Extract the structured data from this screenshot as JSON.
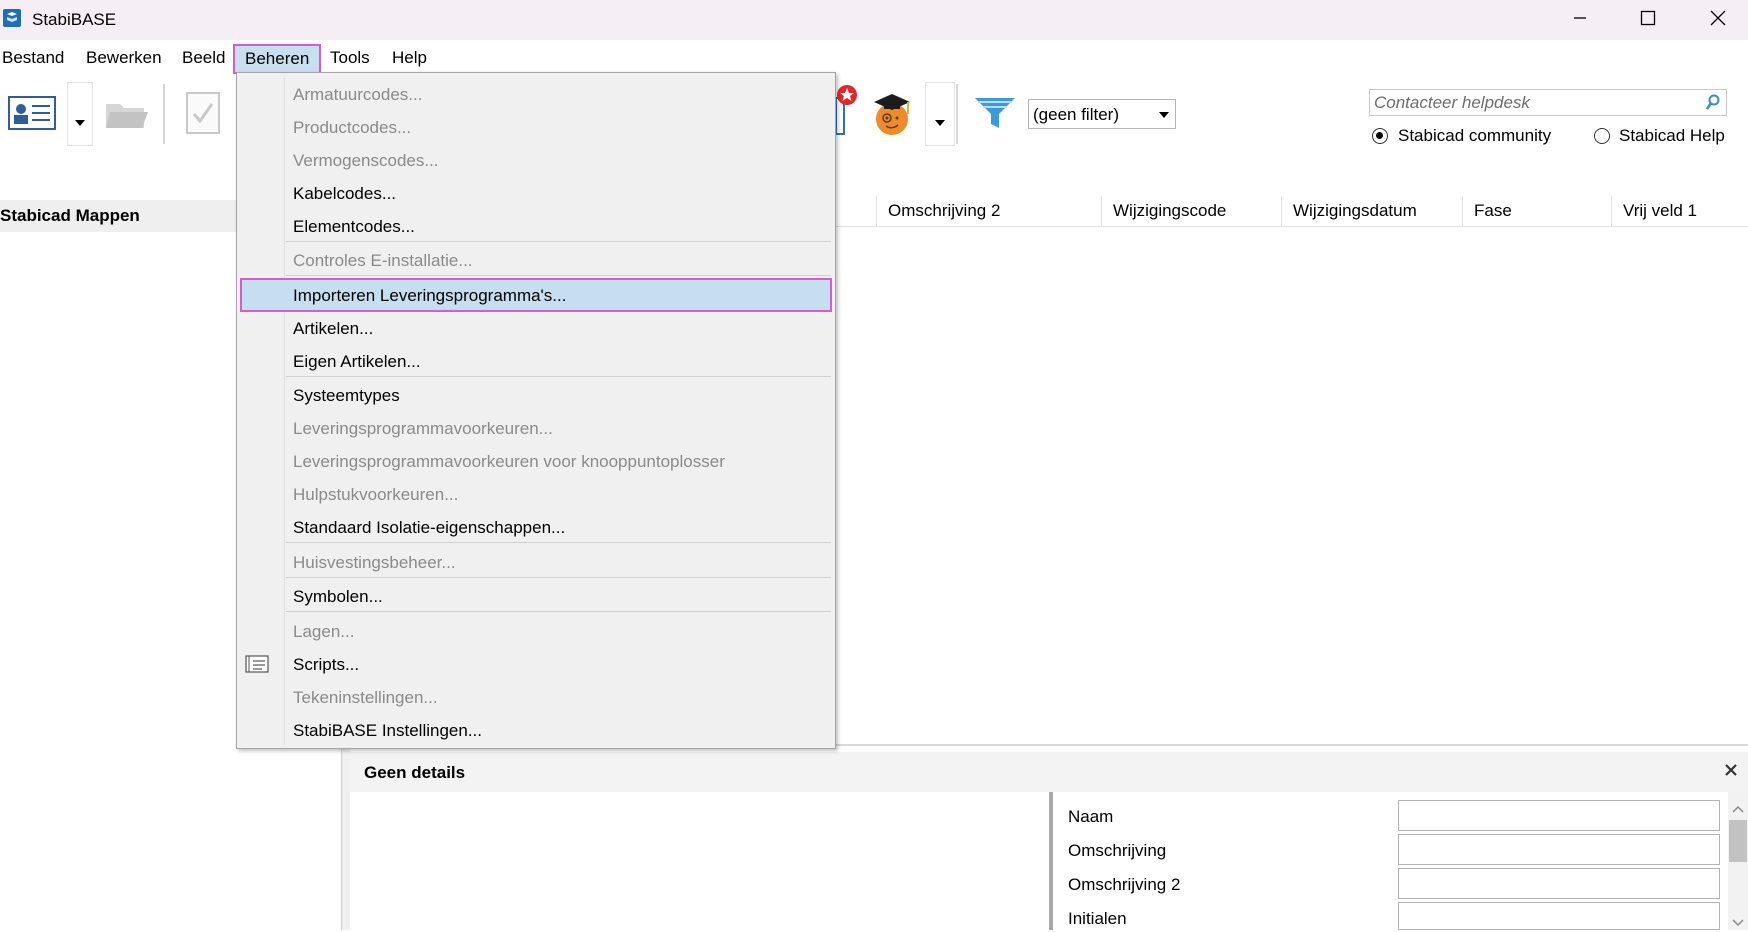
{
  "window": {
    "title": "StabiBASE",
    "controls": {
      "minimize": "minimize-icon",
      "maximize": "maximize-icon",
      "close": "close-icon"
    }
  },
  "menubar": {
    "items": [
      "Bestand",
      "Bewerken",
      "Beeld",
      "Beheren",
      "Tools",
      "Help"
    ],
    "active": "Beheren"
  },
  "toolbar": {
    "icons": [
      "contact-card-icon",
      "dropdown-arrow-icon",
      "open-folder-icon",
      "checklist-icon",
      "notification-icon",
      "student-avatar-icon",
      "dropdown-arrow-icon",
      "filter-icon"
    ],
    "filter_value": "(geen filter)"
  },
  "helpdesk": {
    "placeholder": "Contacteer helpdesk",
    "options": [
      "Stabicad community",
      "Stabicad Help"
    ],
    "selected": "Stabicad community"
  },
  "left_panel": {
    "title": "Stabicad Mappen"
  },
  "columns": [
    "Omschrijving 2",
    "Wijzigingscode",
    "Wijzigingsdatum",
    "Fase",
    "Vrij veld 1"
  ],
  "beheren_menu": {
    "items": [
      {
        "label": "Armatuurcodes...",
        "enabled": false
      },
      {
        "label": "Productcodes...",
        "enabled": false
      },
      {
        "label": "Vermogenscodes...",
        "enabled": false
      },
      {
        "label": "Kabelcodes...",
        "enabled": true
      },
      {
        "label": "Elementcodes...",
        "enabled": true
      },
      {
        "label": "Controles E-installatie...",
        "enabled": false
      },
      {
        "label": "Importeren Leveringsprogramma's...",
        "enabled": true,
        "highlighted": true
      },
      {
        "label": "Artikelen...",
        "enabled": true
      },
      {
        "label": "Eigen Artikelen...",
        "enabled": true
      },
      {
        "label": "Systeemtypes",
        "enabled": true
      },
      {
        "label": "Leveringsprogrammavoorkeuren...",
        "enabled": false
      },
      {
        "label": "Leveringsprogrammavoorkeuren voor knooppuntoplosser",
        "enabled": false
      },
      {
        "label": "Hulpstukvoorkeuren...",
        "enabled": false
      },
      {
        "label": "Standaard Isolatie-eigenschappen...",
        "enabled": true
      },
      {
        "label": "Huisvestingsbeheer...",
        "enabled": false
      },
      {
        "label": "Symbolen...",
        "enabled": true
      },
      {
        "label": "Lagen...",
        "enabled": false
      },
      {
        "label": "Scripts...",
        "enabled": true,
        "icon": "script-icon"
      },
      {
        "label": "Tekeninstellingen...",
        "enabled": false
      },
      {
        "label": "StabiBASE Instellingen...",
        "enabled": true
      }
    ]
  },
  "details": {
    "title": "Geen details",
    "fields": [
      "Naam",
      "Omschrijving",
      "Omschrijving 2",
      "Initialen"
    ]
  }
}
